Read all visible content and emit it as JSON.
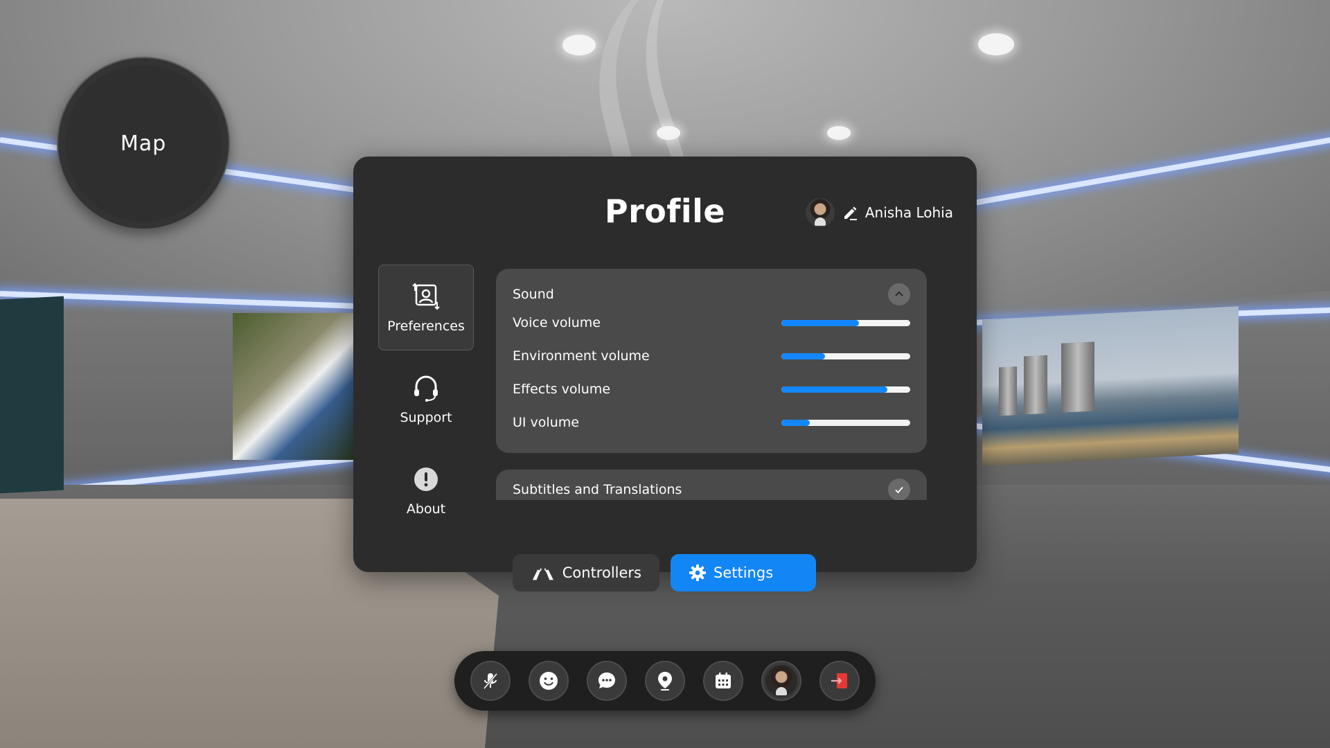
{
  "map": {
    "label": "Map"
  },
  "panel": {
    "title": "Profile",
    "user_name": "Anisha Lohia"
  },
  "nav": [
    {
      "label": "Preferences",
      "icon": "preferences-icon",
      "active": true
    },
    {
      "label": "Support",
      "icon": "headset-icon",
      "active": false
    },
    {
      "label": "About",
      "icon": "info-icon",
      "active": false
    }
  ],
  "sound": {
    "title": "Sound",
    "expanded": true,
    "sliders": [
      {
        "label": "Voice volume",
        "value": 0.6
      },
      {
        "label": "Environment volume",
        "value": 0.34
      },
      {
        "label": "Effects volume",
        "value": 0.82
      },
      {
        "label": "UI volume",
        "value": 0.22
      }
    ]
  },
  "subtitles": {
    "title": "Subtitles and Translations",
    "checked": true
  },
  "tabs": {
    "controllers": "Controllers",
    "settings": "Settings"
  },
  "dock": [
    "microphone-icon",
    "emoji-icon",
    "chat-icon",
    "location-icon",
    "calendar-icon",
    "avatar",
    "exit-icon"
  ],
  "colors": {
    "accent": "#1386f5",
    "panel": "#2c2c2c",
    "card": "#4a4a4a",
    "exit": "#e53935"
  }
}
